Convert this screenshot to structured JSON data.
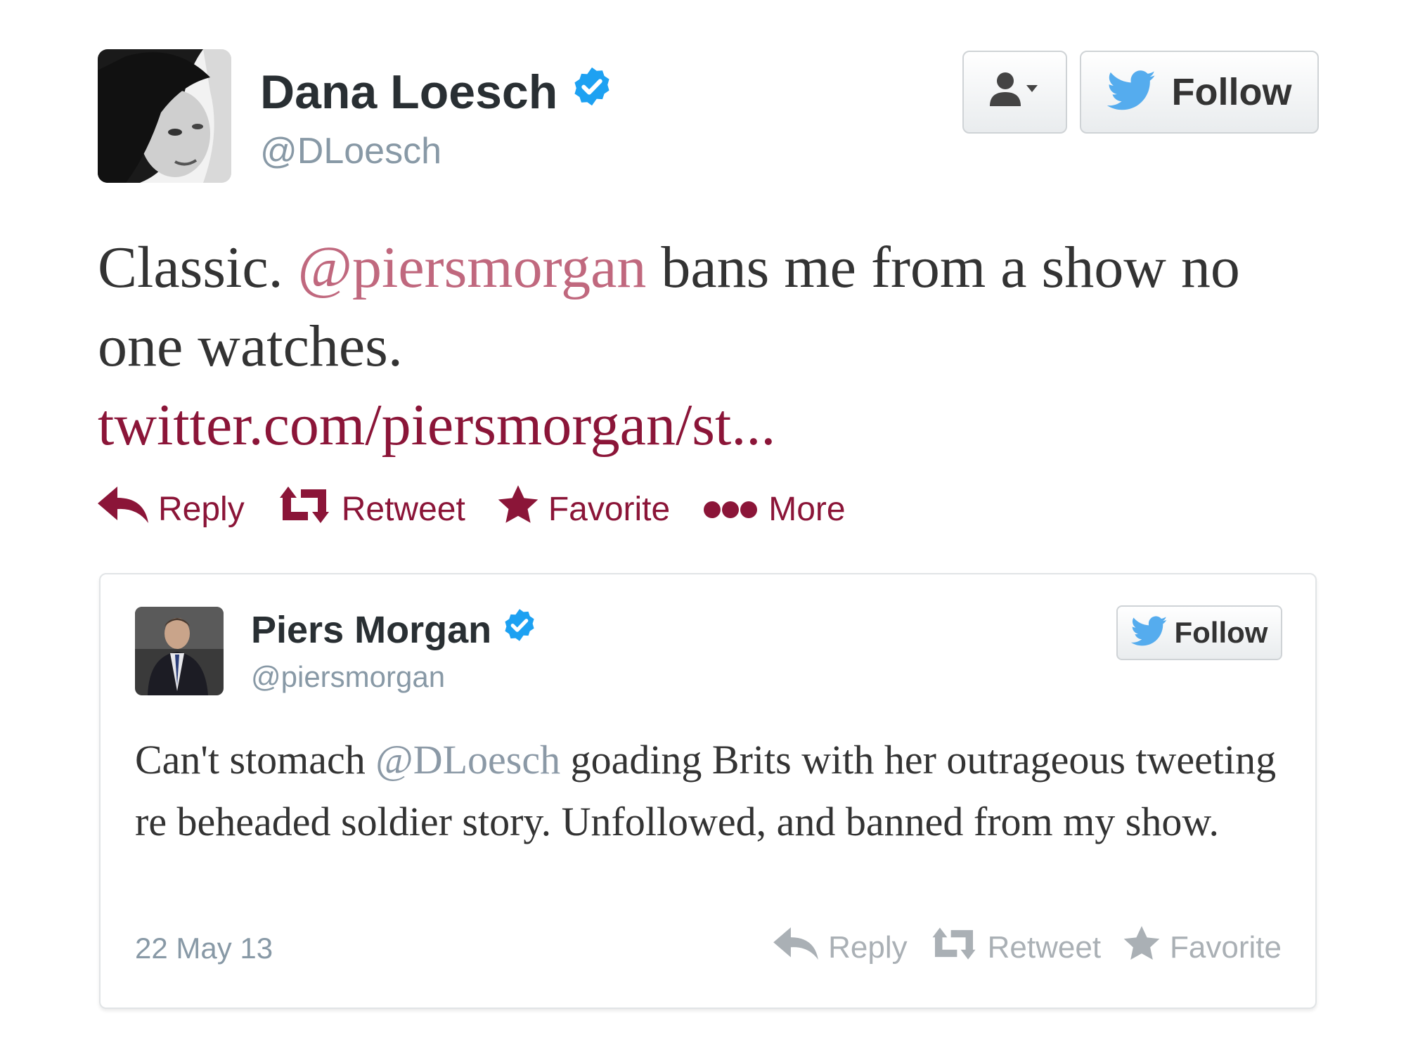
{
  "main_tweet": {
    "display_name": "Dana Loesch",
    "handle": "@DLoesch",
    "follow_label": "Follow",
    "text": {
      "part1": "Classic. ",
      "mention": "@piersmorgan",
      "part2": " bans me from a  show no one watches.",
      "link": "twitter.com/piersmorgan/st..."
    },
    "actions": {
      "reply": "Reply",
      "retweet": "Retweet",
      "favorite": "Favorite",
      "more": "More"
    }
  },
  "quoted_tweet": {
    "display_name": "Piers Morgan",
    "handle": "@piersmorgan",
    "follow_label": "Follow",
    "text": {
      "part1": "Can't stomach ",
      "mention": "@DLoesch",
      "part2": " goading Brits with her outrageous tweeting re beheaded soldier story. Unfollowed, and banned from my show."
    },
    "date": "22 May 13",
    "actions": {
      "reply": "Reply",
      "retweet": "Retweet",
      "favorite": "Favorite"
    }
  },
  "colors": {
    "link": "#8b1538",
    "verified": "#1da1f2",
    "twitter_bird": "#55acee",
    "muted": "#8899a6"
  },
  "icons": [
    "verified-badge-icon",
    "user-dropdown-icon",
    "twitter-bird-icon",
    "reply-icon",
    "retweet-icon",
    "favorite-star-icon",
    "more-dots-icon"
  ]
}
